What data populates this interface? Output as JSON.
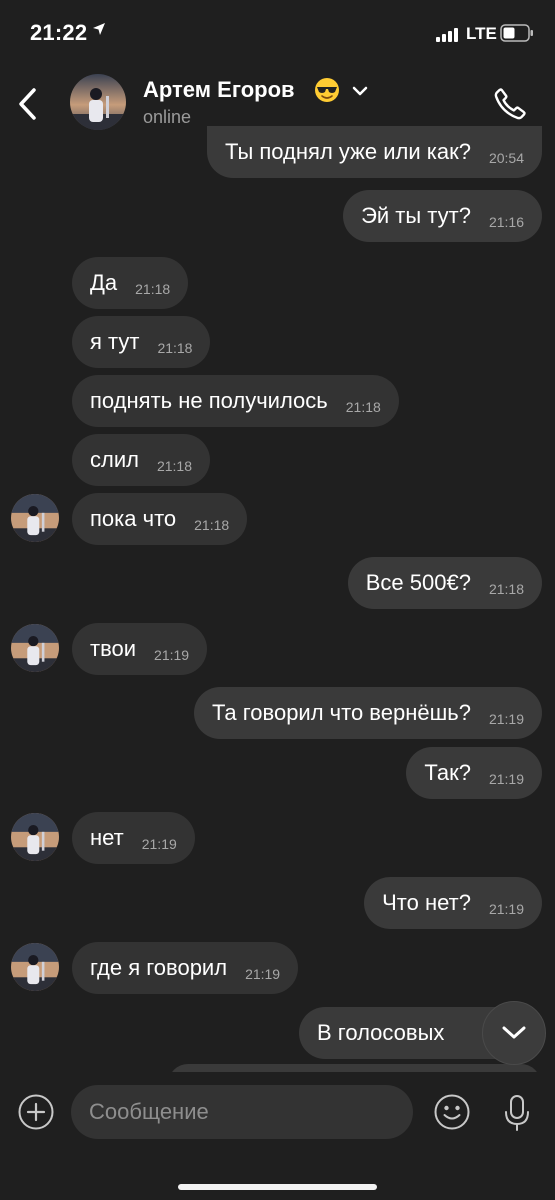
{
  "status_bar": {
    "time": "21:22",
    "network": "LTE",
    "icons": [
      "location-arrow-icon",
      "signal-icon",
      "battery-icon"
    ]
  },
  "header": {
    "name": "Артем Егоров",
    "emoji": "😎",
    "status": "online"
  },
  "messages": [
    {
      "dir": "out",
      "text": "Ты поднял уже или как?",
      "time": "20:54"
    },
    {
      "dir": "out",
      "text": "Эй ты тут?",
      "time": "21:16"
    },
    {
      "dir": "in",
      "text": "Да",
      "time": "21:18"
    },
    {
      "dir": "in",
      "text": "я тут",
      "time": "21:18"
    },
    {
      "dir": "in",
      "text": "поднять не получилось",
      "time": "21:18"
    },
    {
      "dir": "in",
      "text": "слил",
      "time": "21:18"
    },
    {
      "dir": "in",
      "text": "пока что",
      "time": "21:18"
    },
    {
      "dir": "out",
      "text": "Все 500€?",
      "time": "21:18"
    },
    {
      "dir": "in",
      "text": "твои",
      "time": "21:19"
    },
    {
      "dir": "out",
      "text": "Та говорил что вернёшь?",
      "time": "21:19"
    },
    {
      "dir": "out",
      "text": "Так?",
      "time": "21:19"
    },
    {
      "dir": "in",
      "text": "нет",
      "time": "21:19"
    },
    {
      "dir": "out",
      "text": "Что нет?",
      "time": "21:19"
    },
    {
      "dir": "in",
      "text": "где я говорил",
      "time": "21:19"
    },
    {
      "dir": "out",
      "text": "В голосовых",
      "time": ""
    }
  ],
  "composer": {
    "placeholder": "Сообщение"
  },
  "colors": {
    "background": "#1f1f1f",
    "bubble": "#3a3a3a",
    "muted": "#9a9a9a"
  }
}
